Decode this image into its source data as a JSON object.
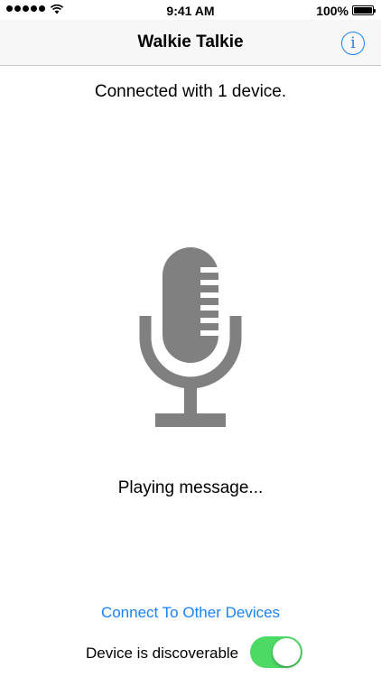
{
  "status_bar": {
    "time": "9:41 AM",
    "battery_percent": "100%",
    "signal_icon": "signal-dots-icon",
    "wifi_icon": "wifi-icon",
    "battery_icon": "battery-icon"
  },
  "nav": {
    "title": "Walkie Talkie",
    "info_label": "i",
    "info_icon": "info-icon"
  },
  "main": {
    "connection_status": "Connected with 1 device.",
    "mic_icon": "microphone-icon",
    "playback_status": "Playing message..."
  },
  "footer": {
    "connect_link": "Connect To Other Devices",
    "discoverable_label": "Device is discoverable",
    "discoverable_on": true
  },
  "colors": {
    "accent": "#1a82fb",
    "toggle_on": "#4cd964",
    "mic": "#808080",
    "nav_background": "#f7f7f7"
  }
}
